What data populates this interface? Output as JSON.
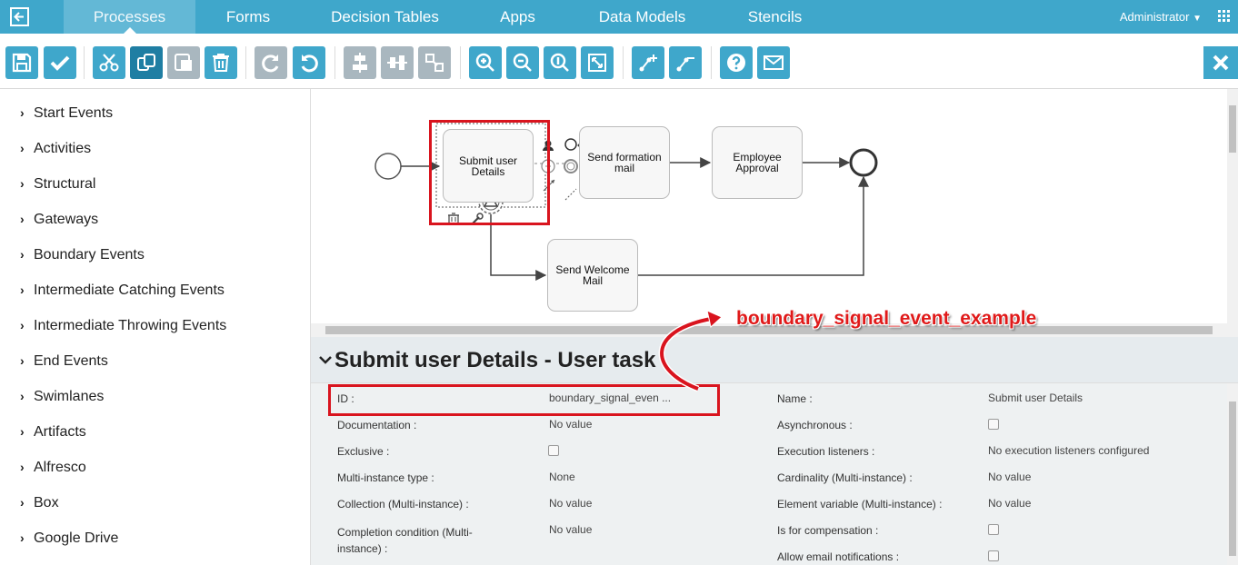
{
  "nav": {
    "tabs": [
      "Processes",
      "Forms",
      "Decision Tables",
      "Apps",
      "Data Models",
      "Stencils"
    ],
    "active_tab": "Processes",
    "user": "Administrator"
  },
  "palette": {
    "items": [
      "Start Events",
      "Activities",
      "Structural",
      "Gateways",
      "Boundary Events",
      "Intermediate Catching Events",
      "Intermediate Throwing Events",
      "End Events",
      "Swimlanes",
      "Artifacts",
      "Alfresco",
      "Box",
      "Google Drive"
    ]
  },
  "diagram": {
    "tasks": {
      "submit": "Submit user Details",
      "send_info": "Send formation mail",
      "approval": "Employee Approval",
      "welcome": "Send Welcome Mail"
    }
  },
  "annotation": "boundary_signal_event_example",
  "properties": {
    "title": "Submit user Details - User task",
    "left": [
      {
        "label": "ID :",
        "value": "boundary_signal_even ..."
      },
      {
        "label": "Documentation :",
        "value": "No value"
      },
      {
        "label": "Exclusive :",
        "value": ""
      },
      {
        "label": "Multi-instance type :",
        "value": "None"
      },
      {
        "label": "Collection (Multi-instance) :",
        "value": "No value"
      },
      {
        "label": "Completion condition (Multi-instance) :",
        "value": "No value"
      }
    ],
    "right": [
      {
        "label": "Name :",
        "value": "Submit user Details"
      },
      {
        "label": "Asynchronous :",
        "value": ""
      },
      {
        "label": "Execution listeners :",
        "value": "No execution listeners configured"
      },
      {
        "label": "Cardinality (Multi-instance) :",
        "value": "No value"
      },
      {
        "label": "Element variable (Multi-instance) :",
        "value": "No value"
      },
      {
        "label": "Is for compensation :",
        "value": ""
      },
      {
        "label": "Allow email notifications :",
        "value": ""
      }
    ]
  },
  "colors": {
    "nav_bg": "#3fa7cb",
    "toolbar_button": "#3fa7cb",
    "highlight": "#d9141e"
  }
}
